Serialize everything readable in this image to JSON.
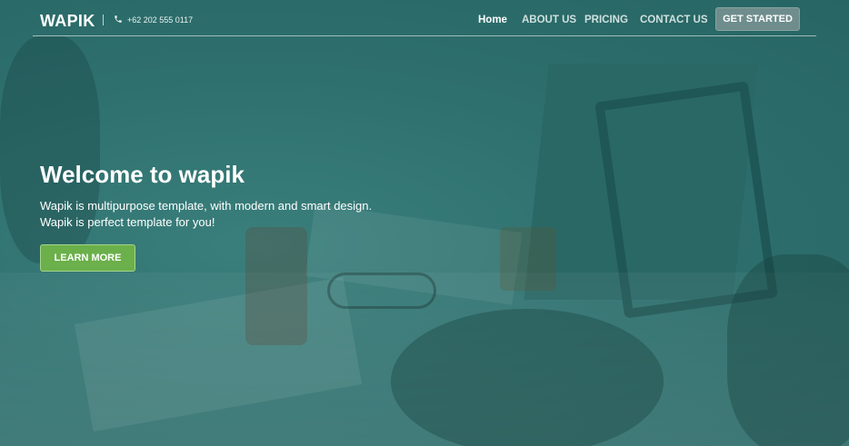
{
  "brand": {
    "logo": "WAPIK",
    "phone": "+62 202 555 0117"
  },
  "nav": {
    "items": [
      {
        "label": "Home",
        "active": true
      },
      {
        "label": "ABOUT US",
        "active": false
      },
      {
        "label": "PRICING",
        "active": false
      },
      {
        "label": "CONTACT US",
        "active": false
      }
    ],
    "cta_label": "GET STARTED"
  },
  "hero": {
    "title": "Welcome to wapik",
    "description": "Wapik is multipurpose template, with modern and smart design. Wapik is perfect template for you!",
    "button_label": "LEARN MORE"
  },
  "colors": {
    "overlay": "#2f716f",
    "cta_button": "#6e8d8c",
    "learn_button": "#6bb04a"
  },
  "icons": {
    "phone": "phone-icon"
  }
}
